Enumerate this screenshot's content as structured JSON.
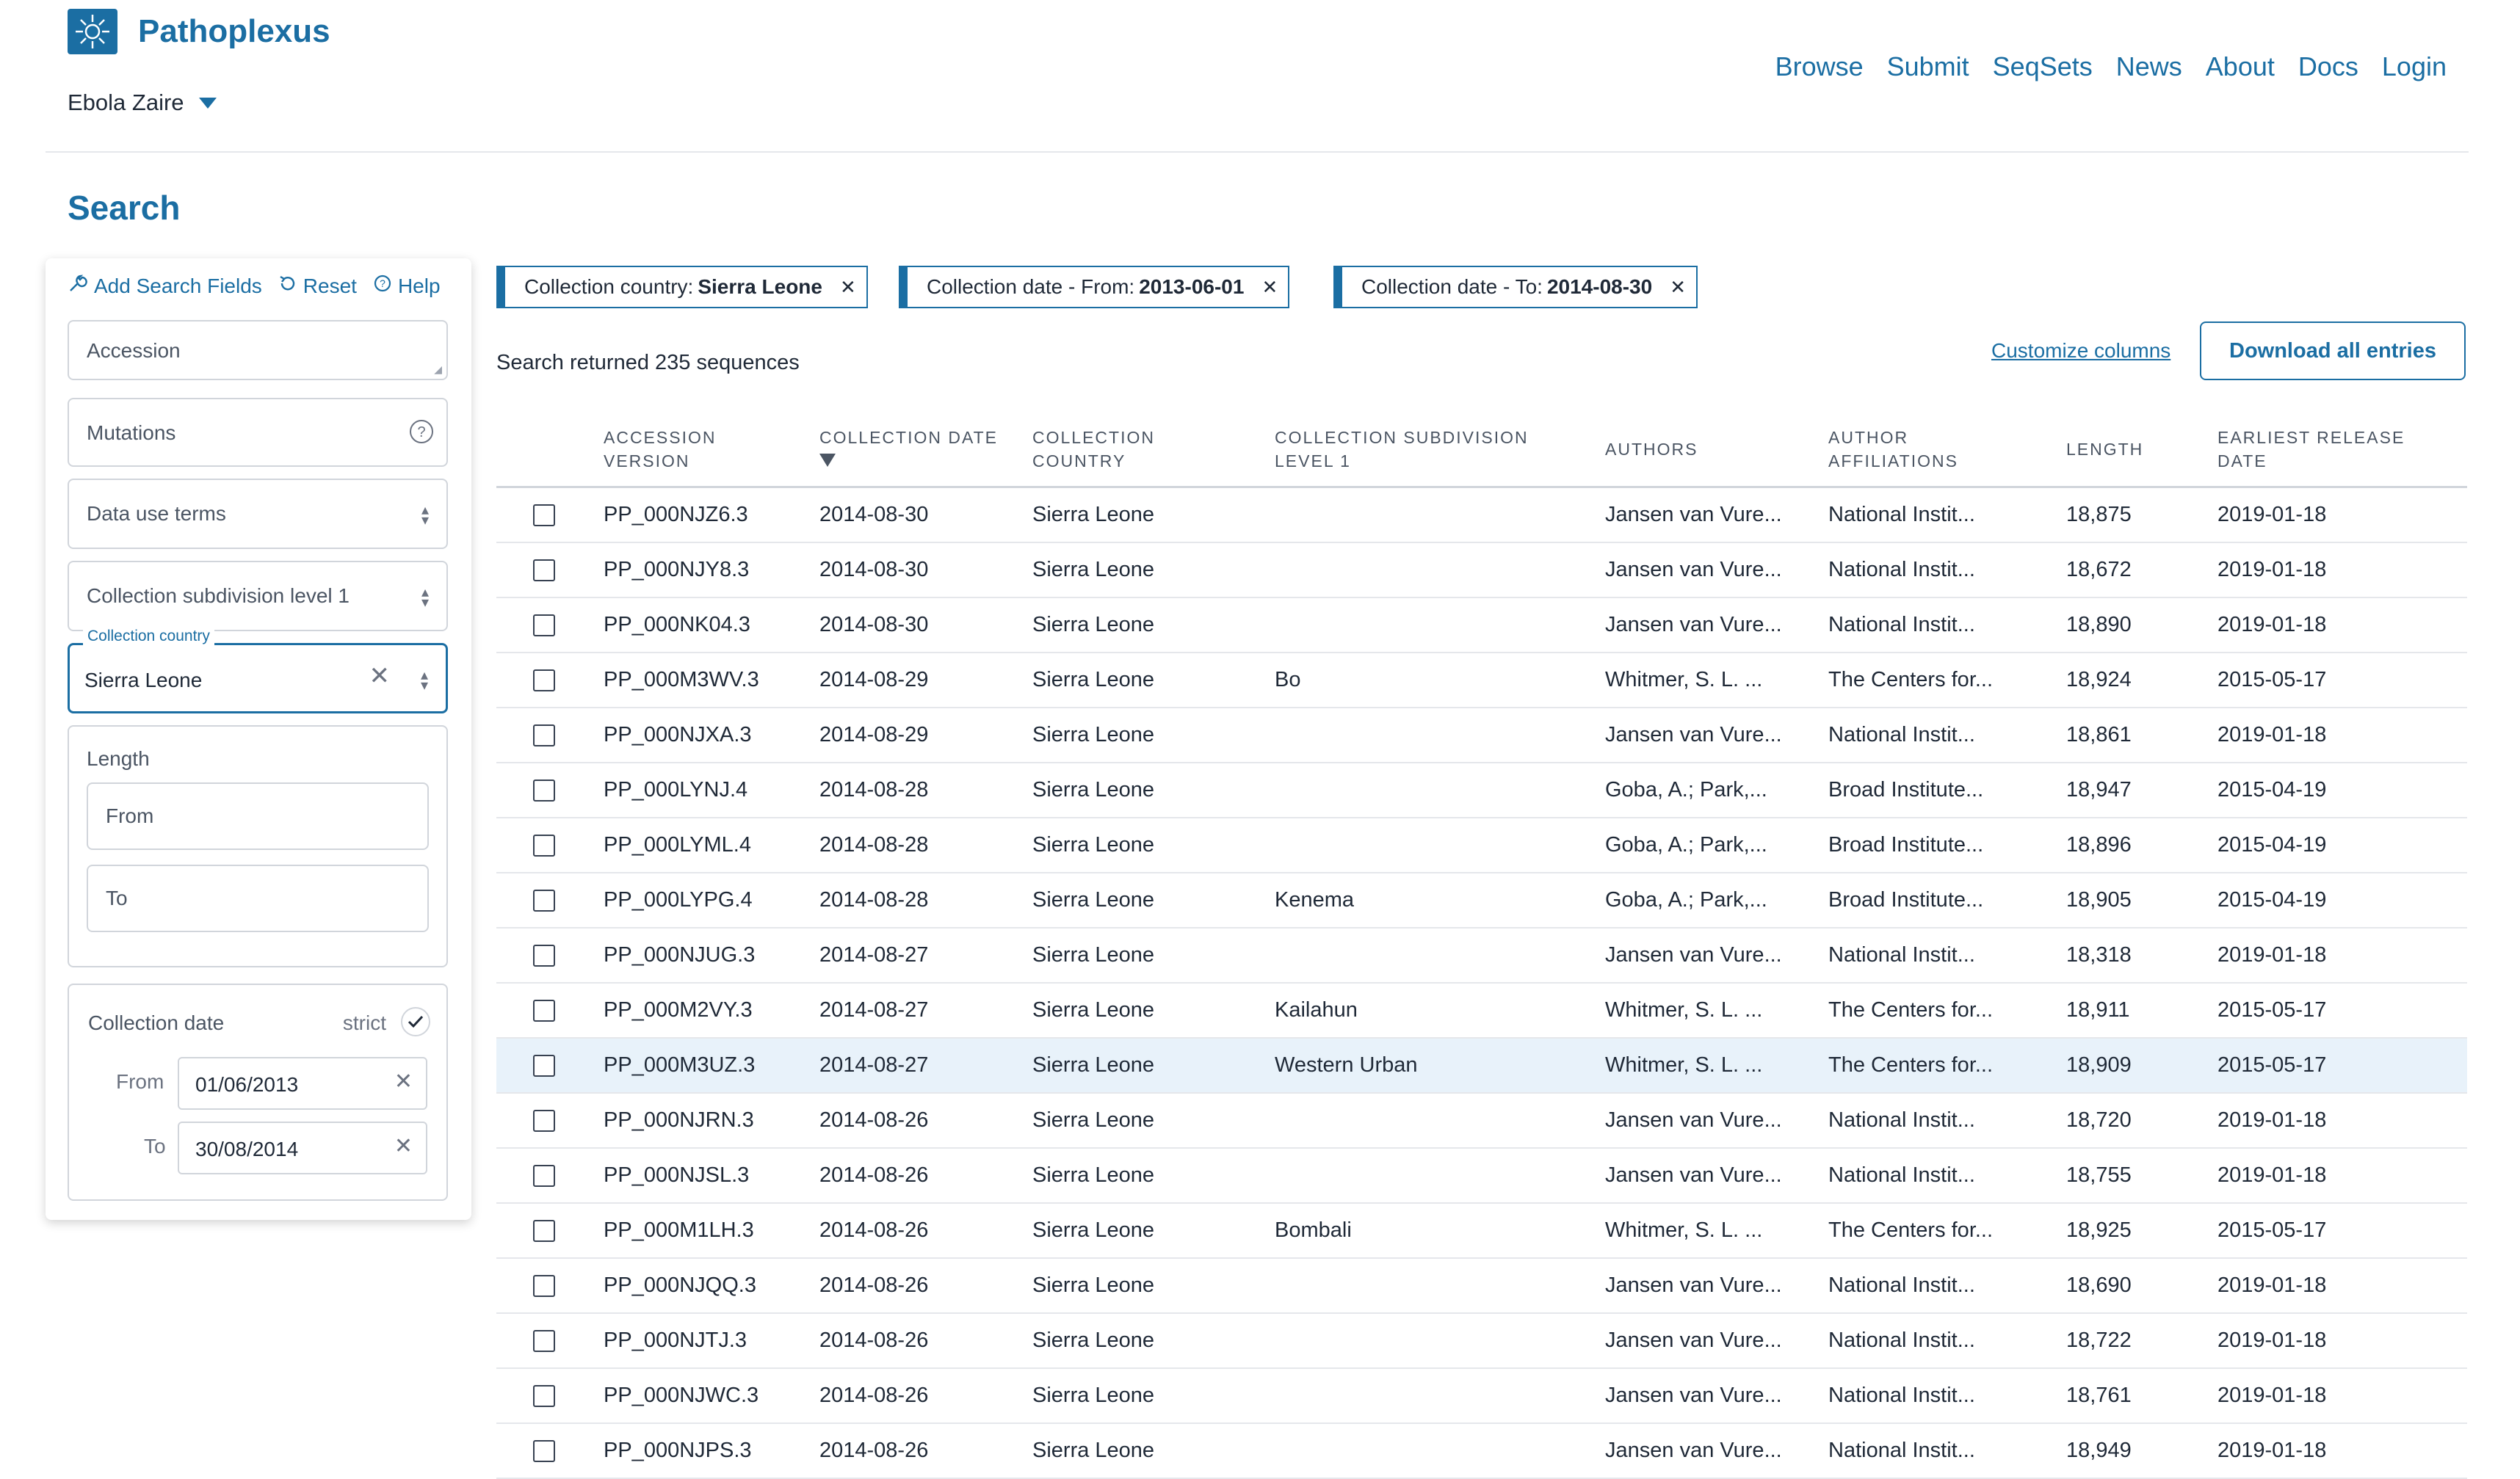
{
  "header": {
    "brand": "Pathoplexus",
    "organism": "Ebola Zaire",
    "nav": [
      "Browse",
      "Submit",
      "SeqSets",
      "News",
      "About",
      "Docs",
      "Login"
    ]
  },
  "page_title": "Search",
  "toolbar": {
    "add_fields": "Add Search Fields",
    "reset": "Reset",
    "help": "Help"
  },
  "filters": {
    "accession_placeholder": "Accession",
    "mutations_placeholder": "Mutations",
    "data_use_terms_placeholder": "Data use terms",
    "subdivision_placeholder": "Collection subdivision level 1",
    "country_label": "Collection country",
    "country_value": "Sierra Leone",
    "length_label": "Length",
    "length_from": "From",
    "length_to": "To",
    "date_label": "Collection date",
    "strict_label": "strict",
    "date_from_label": "From",
    "date_from_value": "01/06/2013",
    "date_to_label": "To",
    "date_to_value": "30/08/2014"
  },
  "chips": [
    {
      "key": "Collection country:",
      "value": "Sierra Leone"
    },
    {
      "key": "Collection date - From:",
      "value": "2013-06-01"
    },
    {
      "key": "Collection date - To:",
      "value": "2014-08-30"
    }
  ],
  "result_count": "Search returned 235 sequences",
  "customize_columns": "Customize columns",
  "download_button": "Download all entries",
  "table": {
    "columns": [
      [
        "ACCESSION",
        "VERSION"
      ],
      [
        "COLLECTION DATE"
      ],
      [
        "COLLECTION",
        "COUNTRY"
      ],
      [
        "COLLECTION SUBDIVISION",
        "LEVEL 1"
      ],
      [
        "AUTHORS"
      ],
      [
        "AUTHOR",
        "AFFILIATIONS"
      ],
      [
        "LENGTH"
      ],
      [
        "EARLIEST RELEASE",
        "DATE"
      ]
    ],
    "rows": [
      [
        "PP_000NJZ6.3",
        "2014-08-30",
        "Sierra Leone",
        "",
        "Jansen van Vure...",
        "National Instit...",
        "18,875",
        "2019-01-18"
      ],
      [
        "PP_000NJY8.3",
        "2014-08-30",
        "Sierra Leone",
        "",
        "Jansen van Vure...",
        "National Instit...",
        "18,672",
        "2019-01-18"
      ],
      [
        "PP_000NK04.3",
        "2014-08-30",
        "Sierra Leone",
        "",
        "Jansen van Vure...",
        "National Instit...",
        "18,890",
        "2019-01-18"
      ],
      [
        "PP_000M3WV.3",
        "2014-08-29",
        "Sierra Leone",
        "Bo",
        "Whitmer, S. L. ...",
        "The Centers for...",
        "18,924",
        "2015-05-17"
      ],
      [
        "PP_000NJXA.3",
        "2014-08-29",
        "Sierra Leone",
        "",
        "Jansen van Vure...",
        "National Instit...",
        "18,861",
        "2019-01-18"
      ],
      [
        "PP_000LYNJ.4",
        "2014-08-28",
        "Sierra Leone",
        "",
        "Goba, A.; Park,...",
        "Broad Institute...",
        "18,947",
        "2015-04-19"
      ],
      [
        "PP_000LYML.4",
        "2014-08-28",
        "Sierra Leone",
        "",
        "Goba, A.; Park,...",
        "Broad Institute...",
        "18,896",
        "2015-04-19"
      ],
      [
        "PP_000LYPG.4",
        "2014-08-28",
        "Sierra Leone",
        "Kenema",
        "Goba, A.; Park,...",
        "Broad Institute...",
        "18,905",
        "2015-04-19"
      ],
      [
        "PP_000NJUG.3",
        "2014-08-27",
        "Sierra Leone",
        "",
        "Jansen van Vure...",
        "National Instit...",
        "18,318",
        "2019-01-18"
      ],
      [
        "PP_000M2VY.3",
        "2014-08-27",
        "Sierra Leone",
        "Kailahun",
        "Whitmer, S. L. ...",
        "The Centers for...",
        "18,911",
        "2015-05-17"
      ],
      [
        "PP_000M3UZ.3",
        "2014-08-27",
        "Sierra Leone",
        "Western Urban",
        "Whitmer, S. L. ...",
        "The Centers for...",
        "18,909",
        "2015-05-17"
      ],
      [
        "PP_000NJRN.3",
        "2014-08-26",
        "Sierra Leone",
        "",
        "Jansen van Vure...",
        "National Instit...",
        "18,720",
        "2019-01-18"
      ],
      [
        "PP_000NJSL.3",
        "2014-08-26",
        "Sierra Leone",
        "",
        "Jansen van Vure...",
        "National Instit...",
        "18,755",
        "2019-01-18"
      ],
      [
        "PP_000M1LH.3",
        "2014-08-26",
        "Sierra Leone",
        "Bombali",
        "Whitmer, S. L. ...",
        "The Centers for...",
        "18,925",
        "2015-05-17"
      ],
      [
        "PP_000NJQQ.3",
        "2014-08-26",
        "Sierra Leone",
        "",
        "Jansen van Vure...",
        "National Instit...",
        "18,690",
        "2019-01-18"
      ],
      [
        "PP_000NJTJ.3",
        "2014-08-26",
        "Sierra Leone",
        "",
        "Jansen van Vure...",
        "National Instit...",
        "18,722",
        "2019-01-18"
      ],
      [
        "PP_000NJWC.3",
        "2014-08-26",
        "Sierra Leone",
        "",
        "Jansen van Vure...",
        "National Instit...",
        "18,761",
        "2019-01-18"
      ],
      [
        "PP_000NJPS.3",
        "2014-08-26",
        "Sierra Leone",
        "",
        "Jansen van Vure...",
        "National Instit...",
        "18,949",
        "2019-01-18"
      ]
    ]
  },
  "colors": {
    "accent": "#1b6ea3",
    "highlight_row": "#e8f2fa"
  }
}
